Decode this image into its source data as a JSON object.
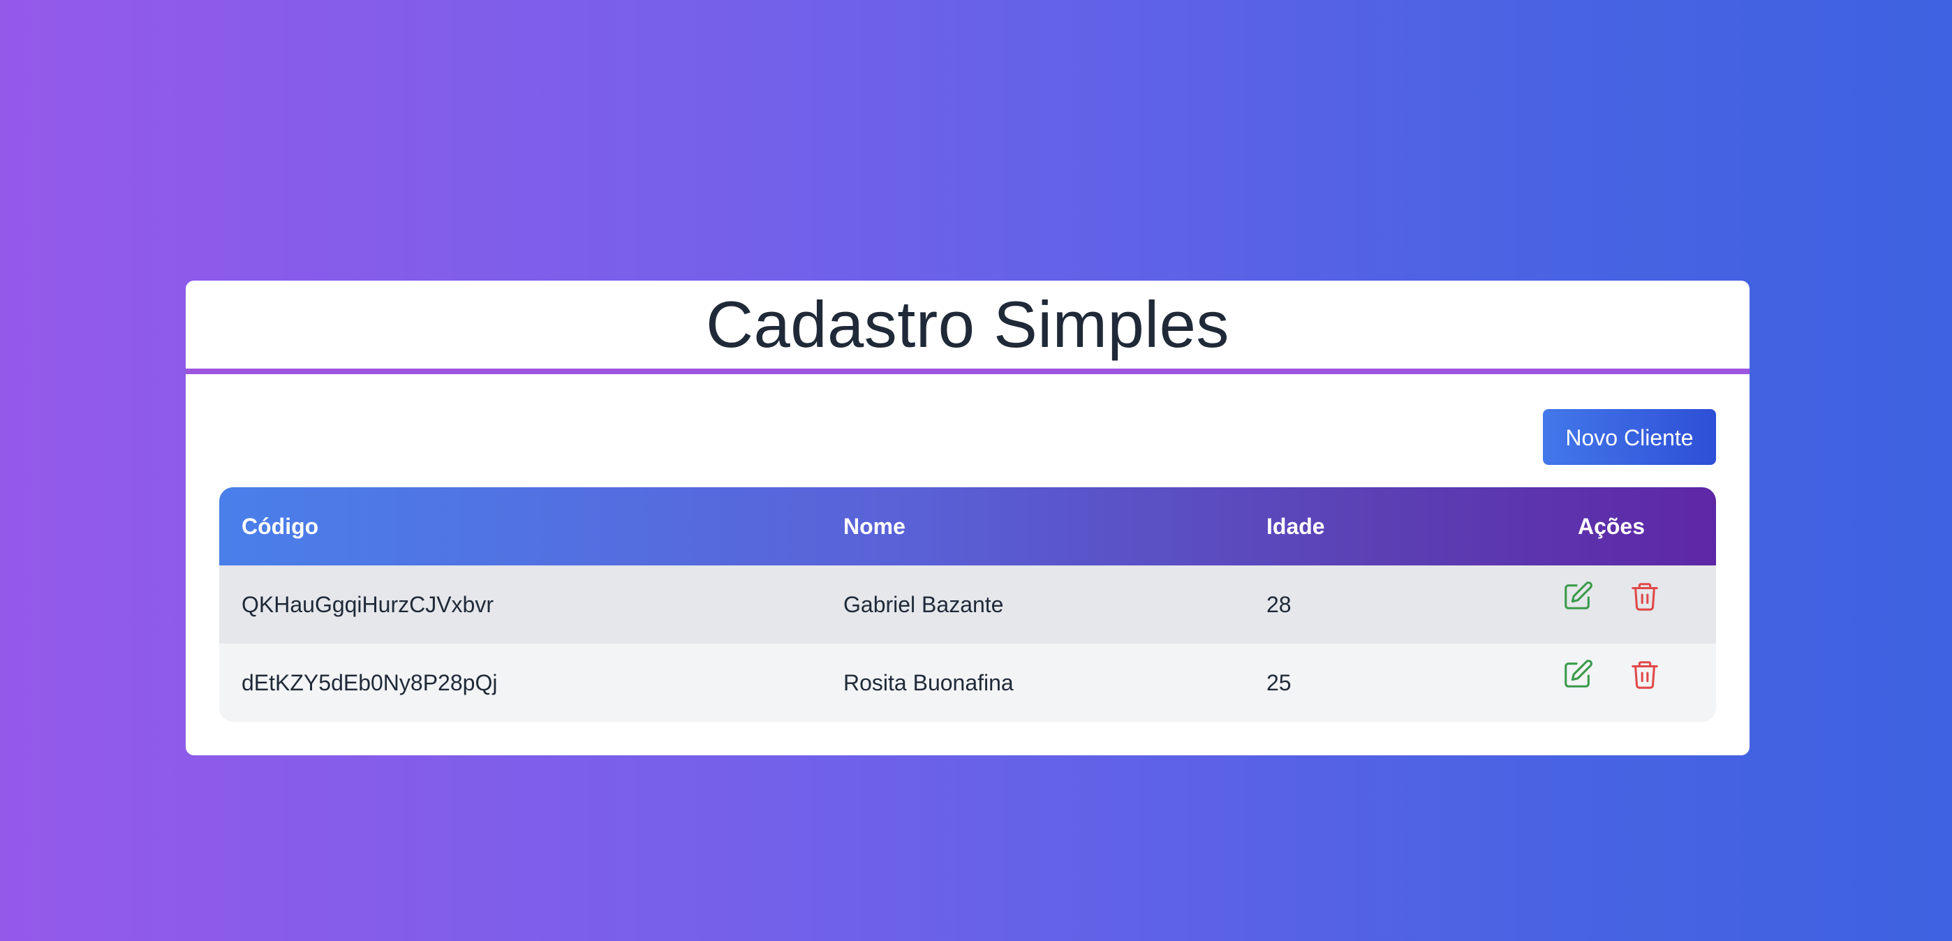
{
  "header": {
    "title": "Cadastro Simples"
  },
  "toolbar": {
    "new_label": "Novo Cliente"
  },
  "table": {
    "columns": [
      "Código",
      "Nome",
      "Idade",
      "Ações"
    ],
    "rows": [
      {
        "codigo": "QKHauGgqiHurzCJVxbvr",
        "nome": "Gabriel Bazante",
        "idade": "28"
      },
      {
        "codigo": "dEtKZY5dEb0Ny8P28pQj",
        "nome": "Rosita Buonafina",
        "idade": "25"
      }
    ],
    "row_actions": [
      "edit-icon",
      "trash-icon"
    ]
  },
  "colors": {
    "edit_icon": "#3a9a4a",
    "delete_icon": "#e04848",
    "header_divider": "#9b55de"
  }
}
